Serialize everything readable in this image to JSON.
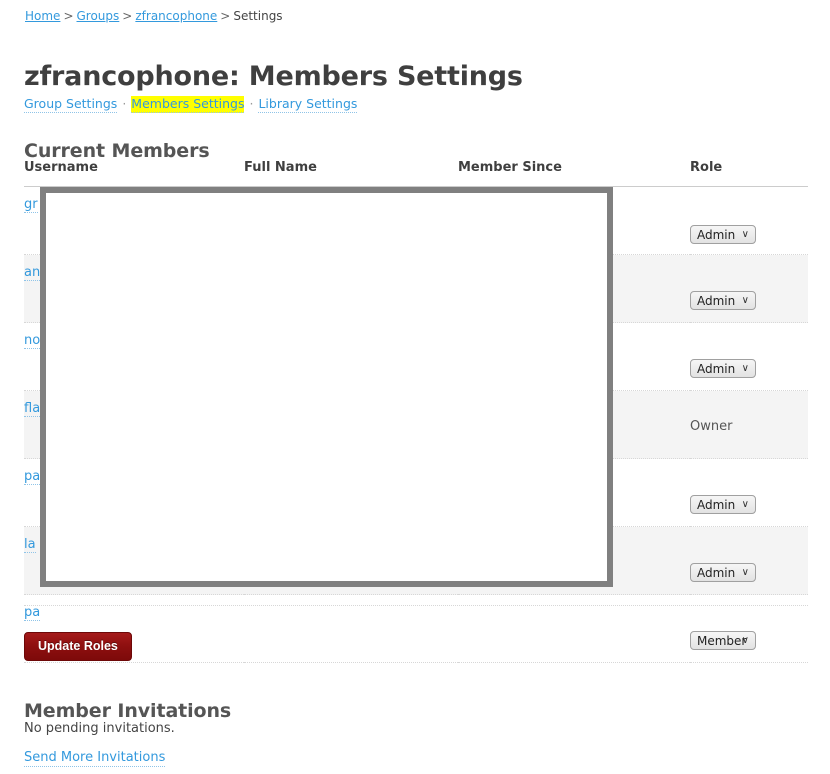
{
  "breadcrumb": {
    "items": [
      {
        "label": "Home",
        "link": true
      },
      {
        "label": "Groups",
        "link": true
      },
      {
        "label": "zfrancophone",
        "link": true
      },
      {
        "label": "Settings",
        "link": false
      }
    ],
    "separator": ">"
  },
  "page_title": "zfrancophone: Members Settings",
  "settings_nav": {
    "separator": "·",
    "items": [
      {
        "label": "Group Settings",
        "active": false
      },
      {
        "label": "Members Settings",
        "active": true
      },
      {
        "label": "Library Settings",
        "active": false
      }
    ],
    "highlight_color": "#ffff00"
  },
  "members_section": {
    "heading": "Current Members",
    "columns": [
      "Username",
      "Full Name",
      "Member Since",
      "Role"
    ],
    "rows": [
      {
        "username": "gr",
        "full_name": "",
        "member_since": "",
        "role": "Admin",
        "role_type": "select",
        "alt": false
      },
      {
        "username": "an",
        "full_name": "",
        "member_since": "",
        "role": "Admin",
        "role_type": "select",
        "alt": true
      },
      {
        "username": "no",
        "full_name": "",
        "member_since": "",
        "role": "Admin",
        "role_type": "select",
        "alt": false
      },
      {
        "username": "fla",
        "full_name": "",
        "member_since": "",
        "role": "Owner",
        "role_type": "static",
        "alt": true
      },
      {
        "username": "pa",
        "full_name": "",
        "member_since": "",
        "role": "Admin",
        "role_type": "select",
        "alt": false
      },
      {
        "username": "la",
        "full_name": "",
        "member_since": "",
        "role": "Admin",
        "role_type": "select",
        "alt": true
      },
      {
        "username": "pa",
        "full_name": "",
        "member_since": "",
        "role": "Member",
        "role_type": "select",
        "alt": false
      }
    ],
    "role_options": [
      "Admin",
      "Member",
      "Owner"
    ],
    "chevron": "∨"
  },
  "update_roles_button": {
    "label": "Update Roles",
    "color": "#8d0f0f"
  },
  "invitations_section": {
    "heading": "Member Invitations",
    "empty_text": "No pending invitations.",
    "link_label": "Send More Invitations"
  },
  "overlay": {
    "border_color": "#808080",
    "fill_color": "#ffffff"
  }
}
